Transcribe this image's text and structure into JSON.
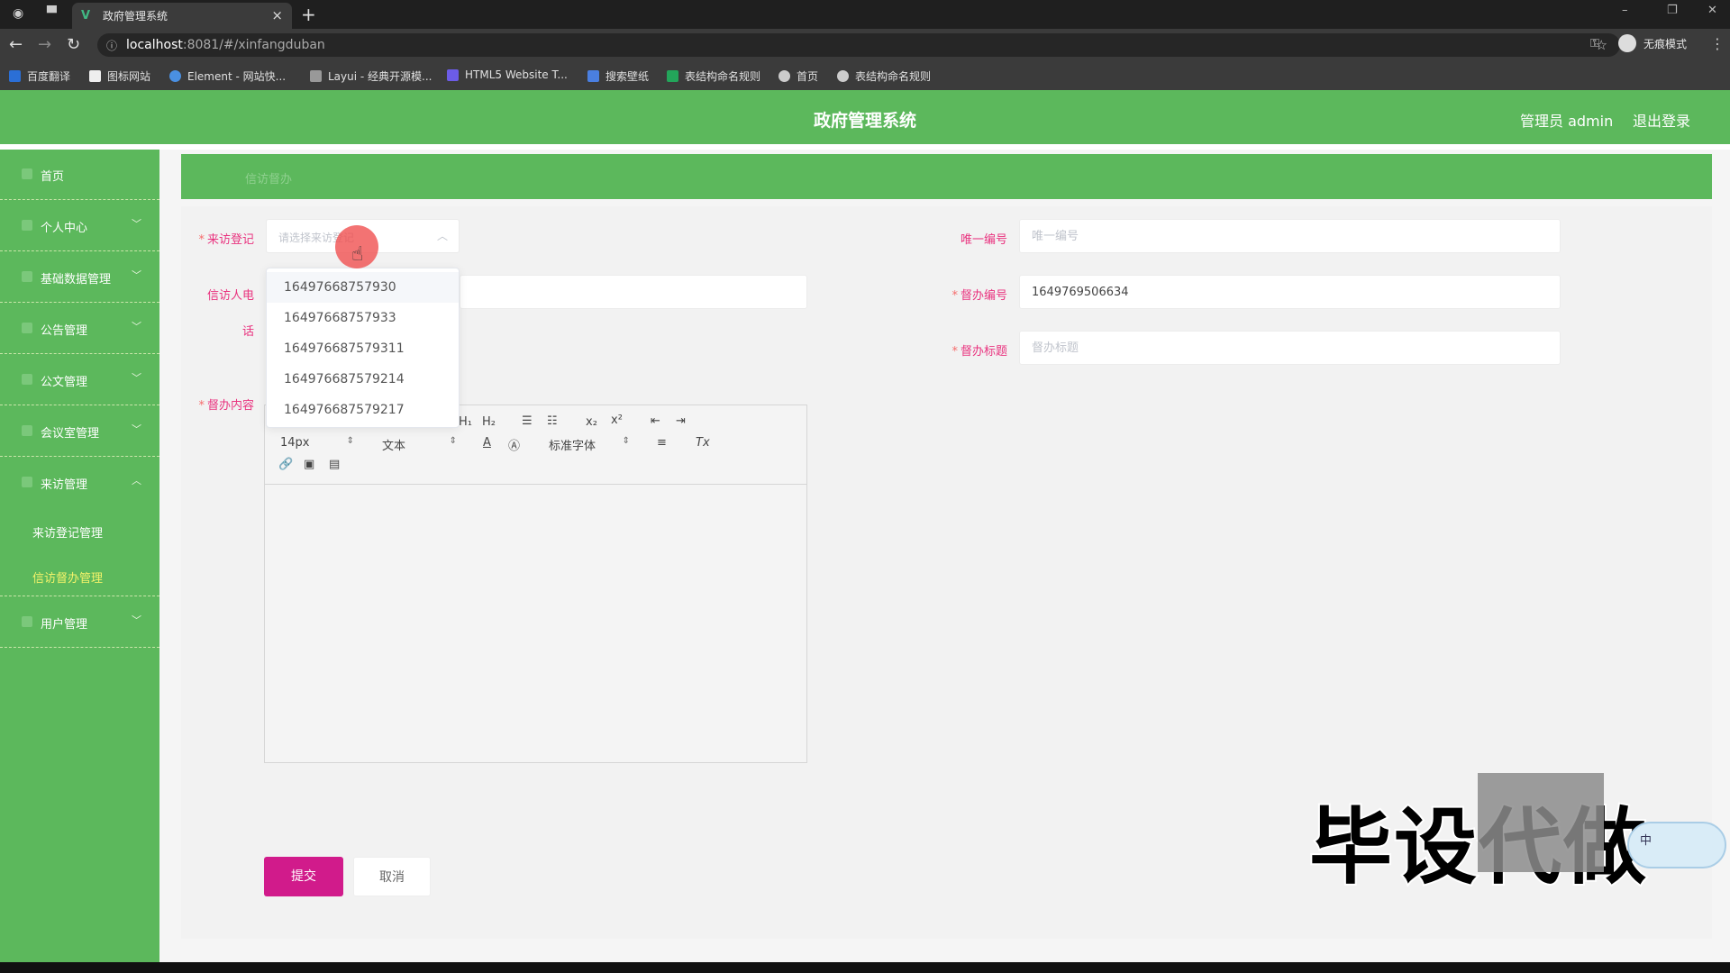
{
  "browser": {
    "tab_title": "政府管理系统",
    "url_host": "localhost",
    "url_rest": ":8081/#/xinfangduban",
    "incognito_label": "无痕模式",
    "bookmarks": [
      "百度翻译",
      "图标网站",
      "Element - 网站快...",
      "Layui - 经典开源模...",
      "HTML5 Website T...",
      "搜索壁纸",
      "表结构命名规则",
      "首页",
      "表结构命名规则"
    ]
  },
  "header": {
    "title": "政府管理系统",
    "user": "管理员 admin",
    "logout": "退出登录"
  },
  "sidebar": {
    "items": [
      {
        "label": "首页"
      },
      {
        "label": "个人中心"
      },
      {
        "label": "基础数据管理"
      },
      {
        "label": "公告管理"
      },
      {
        "label": "公文管理"
      },
      {
        "label": "会议室管理"
      },
      {
        "label": "来访管理"
      },
      {
        "label": "用户管理"
      }
    ],
    "sub_items": [
      "来访登记管理",
      "信访督办管理"
    ]
  },
  "breadcrumb": "信访督办",
  "form": {
    "visit_label": "来访登记",
    "visit_placeholder": "请选择来访登记",
    "phone_label_1": "信访人电",
    "phone_label_2": "话",
    "content_label": "督办内容",
    "unique_label": "唯一编号",
    "unique_placeholder": "唯一编号",
    "number_label": "督办编号",
    "number_value": "1649769506634",
    "title_label": "督办标题",
    "title_placeholder": "督办标题",
    "submit": "提交",
    "cancel": "取消"
  },
  "dropdown_options": [
    "16497668757930",
    "16497668757933",
    "164976687579311",
    "164976687579214",
    "164976687579217"
  ],
  "editor": {
    "font_size": "14px",
    "text_style": "文本",
    "font_family": "标准字体"
  },
  "watermark": "毕设代做",
  "ime": "中",
  "colors": {
    "primary_green": "#5cb85c",
    "label_pink": "#e9337f",
    "submit_magenta": "#d11b8b",
    "active_yellow": "#f3f36a"
  }
}
